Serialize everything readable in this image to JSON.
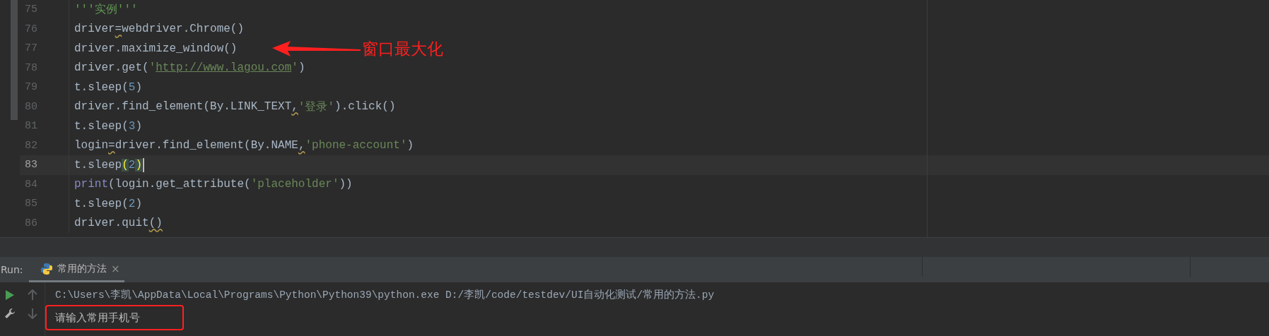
{
  "editor": {
    "lines": [
      {
        "number": "75",
        "current": false,
        "tokens": [
          {
            "kind": "docstring",
            "text": "'''实例'''"
          }
        ]
      },
      {
        "number": "76",
        "current": false,
        "tokens": [
          {
            "kind": "text",
            "text": "driver"
          },
          {
            "kind": "warning",
            "text": "="
          },
          {
            "kind": "text",
            "text": "webdriver.Chrome()"
          }
        ]
      },
      {
        "number": "77",
        "current": false,
        "tokens": [
          {
            "kind": "text",
            "text": "driver.maximize_window()"
          }
        ]
      },
      {
        "number": "78",
        "current": false,
        "tokens": [
          {
            "kind": "text",
            "text": "driver.get("
          },
          {
            "kind": "string",
            "text": "'"
          },
          {
            "kind": "url",
            "text": "http://www.lagou.com"
          },
          {
            "kind": "string",
            "text": "'"
          },
          {
            "kind": "text",
            "text": ")"
          }
        ]
      },
      {
        "number": "79",
        "current": false,
        "tokens": [
          {
            "kind": "text",
            "text": "t.sleep("
          },
          {
            "kind": "number",
            "text": "5"
          },
          {
            "kind": "text",
            "text": ")"
          }
        ]
      },
      {
        "number": "80",
        "current": false,
        "tokens": [
          {
            "kind": "text",
            "text": "driver.find_element(By.LINK_TEXT"
          },
          {
            "kind": "warning",
            "text": ","
          },
          {
            "kind": "string",
            "text": "'登录'"
          },
          {
            "kind": "text",
            "text": ").click()"
          }
        ]
      },
      {
        "number": "81",
        "current": false,
        "tokens": [
          {
            "kind": "text",
            "text": "t.sleep("
          },
          {
            "kind": "number",
            "text": "3"
          },
          {
            "kind": "text",
            "text": ")"
          }
        ]
      },
      {
        "number": "82",
        "current": false,
        "tokens": [
          {
            "kind": "text",
            "text": "login"
          },
          {
            "kind": "warning",
            "text": "="
          },
          {
            "kind": "text",
            "text": "driver.find_element(By.NAME"
          },
          {
            "kind": "warning",
            "text": ","
          },
          {
            "kind": "string",
            "text": "'phone-account'"
          },
          {
            "kind": "text",
            "text": ")"
          }
        ]
      },
      {
        "number": "83",
        "current": true,
        "tokens": [
          {
            "kind": "text",
            "text": "t.sleep"
          },
          {
            "kind": "brace",
            "text": "("
          },
          {
            "kind": "number",
            "text": "2"
          },
          {
            "kind": "brace",
            "text": ")"
          }
        ]
      },
      {
        "number": "84",
        "current": false,
        "tokens": [
          {
            "kind": "builtin",
            "text": "print"
          },
          {
            "kind": "text",
            "text": "(login.get_attribute("
          },
          {
            "kind": "string",
            "text": "'placeholder'"
          },
          {
            "kind": "text",
            "text": "))"
          }
        ]
      },
      {
        "number": "85",
        "current": false,
        "tokens": [
          {
            "kind": "text",
            "text": "t.sleep("
          },
          {
            "kind": "number",
            "text": "2"
          },
          {
            "kind": "text",
            "text": ")"
          }
        ]
      },
      {
        "number": "86",
        "current": false,
        "tokens": [
          {
            "kind": "text",
            "text": "driver.quit"
          },
          {
            "kind": "warning",
            "text": "()"
          }
        ]
      }
    ]
  },
  "annotation": {
    "text": "窗口最大化"
  },
  "run_panel": {
    "label": "Run:",
    "tabs": [
      {
        "label": "常用的方法",
        "close": "×",
        "selected": true
      }
    ],
    "output": [
      {
        "kind": "command",
        "text": "C:\\Users\\李凯\\AppData\\Local\\Programs\\Python\\Python39\\python.exe D:/李凯/code/testdev/UI自动化测试/常用的方法.py",
        "highlighted": false
      },
      {
        "kind": "output",
        "text": "请输入常用手机号",
        "highlighted": true
      }
    ]
  }
}
